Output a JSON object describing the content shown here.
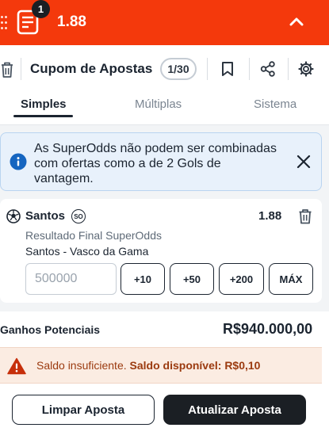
{
  "colors": {
    "brand": "#f4390c",
    "dark": "#1b1f24",
    "info_bg": "#e8f1fb",
    "info_icon": "#1565c0",
    "warn_icon": "#c62f0a",
    "warn_text": "#9b3a0f"
  },
  "topbar": {
    "badge": "1",
    "total_odds": "1.88",
    "slip_icon": "bet-slip-icon",
    "collapse_icon": "chevron-up-icon"
  },
  "header": {
    "title": "Cupom de Apostas",
    "counter": "1/30",
    "icons": [
      "trash-icon",
      "bookmark-icon",
      "share-icon",
      "gear-icon"
    ]
  },
  "tabs": [
    {
      "label": "Simples",
      "active": true
    },
    {
      "label": "Múltiplas",
      "active": false
    },
    {
      "label": "Sistema",
      "active": false
    }
  ],
  "info": {
    "message": "As SuperOdds não podem ser combinadas com ofertas como a de 2 Gols de vantagem."
  },
  "selection": {
    "team": "Santos",
    "badge": "SO",
    "odds": "1.88",
    "market": "Resultado Final SuperOdds",
    "event": "Santos - Vasco da Gama",
    "stake_placeholder": "500000",
    "quick_stakes": [
      "+10",
      "+50",
      "+200",
      "MÁX"
    ]
  },
  "summary": {
    "gains_label": "Ganhos Potenciais",
    "gains_value": "R$940.000,00"
  },
  "warning": {
    "text": "Saldo insuficiente.",
    "bold_text": "Saldo disponível: R$0,10"
  },
  "actions": {
    "clear_label": "Limpar Aposta",
    "update_label": "Atualizar Aposta"
  }
}
